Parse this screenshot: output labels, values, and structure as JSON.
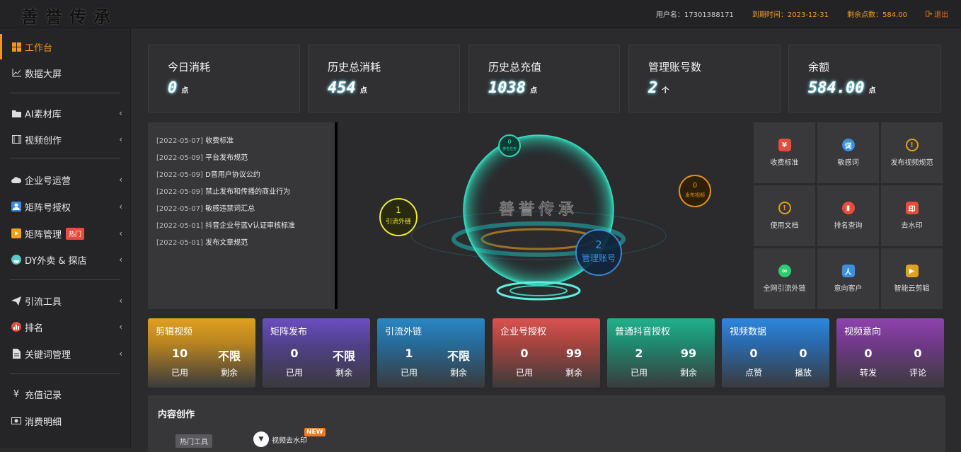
{
  "header": {
    "logo": "善誉传承",
    "user": "用户名：17301388171",
    "expire": "到期时间：2023-12-31",
    "points": "剩余点数：584.00",
    "logout": "退出"
  },
  "sidebar": {
    "items": [
      {
        "label": "工作台",
        "icon": "windows-icon"
      },
      {
        "label": "数据大屏",
        "icon": "chart-icon"
      },
      {
        "label": "AI素材库",
        "icon": "folder-icon"
      },
      {
        "label": "视频创作",
        "icon": "film-icon"
      },
      {
        "label": "企业号运营",
        "icon": "cloud-icon"
      },
      {
        "label": "矩阵号授权",
        "icon": "user-card-icon"
      },
      {
        "label": "矩阵管理",
        "icon": "play-icon",
        "badge": "热门"
      },
      {
        "label": "DY外卖 & 探店",
        "icon": "food-icon"
      },
      {
        "label": "引流工具",
        "icon": "send-icon"
      },
      {
        "label": "排名",
        "icon": "bar-icon"
      },
      {
        "label": "关键词管理",
        "icon": "doc-icon"
      },
      {
        "label": "充值记录",
        "icon": "yen-icon"
      },
      {
        "label": "消费明细",
        "icon": "money-icon"
      }
    ]
  },
  "cards": [
    {
      "label": "今日消耗",
      "value": "0",
      "unit": "点"
    },
    {
      "label": "历史总消耗",
      "value": "454",
      "unit": "点"
    },
    {
      "label": "历史总充值",
      "value": "1038",
      "unit": "点"
    },
    {
      "label": "管理账号数",
      "value": "2",
      "unit": "个"
    },
    {
      "label": "余额",
      "value": "584.00",
      "unit": "点"
    }
  ],
  "notices": [
    {
      "date": "[2022-05-07]",
      "title": "收费标准"
    },
    {
      "date": "[2022-05-09]",
      "title": "平台发布规范"
    },
    {
      "date": "[2022-05-09]",
      "title": "D音用户协议公约"
    },
    {
      "date": "[2022-05-09]",
      "title": "禁止发布和传播的商业行为"
    },
    {
      "date": "[2022-05-07]",
      "title": "敏感违禁词汇总"
    },
    {
      "date": "[2022-05-01]",
      "title": "抖音企业号蓝V认证审核标准"
    },
    {
      "date": "[2022-05-01]",
      "title": "发布文章规范"
    }
  ],
  "globe": {
    "center_text": "善誉传承",
    "bubbles": [
      {
        "num": "0",
        "label": "排名任务",
        "color": "#2ed8b0"
      },
      {
        "num": "1",
        "label": "引流外链",
        "color": "#e8e83a"
      },
      {
        "num": "0",
        "label": "发布视频",
        "color": "#e0901a"
      },
      {
        "num": "2",
        "label": "管理账号",
        "color": "#3a8fe0"
      }
    ]
  },
  "quick_links": [
    {
      "label": "收费标准",
      "icon": "tag-icon",
      "color": "#e74c3c",
      "glyph": "¥"
    },
    {
      "label": "敏感词",
      "icon": "shield-icon",
      "color": "#3a8fe0",
      "glyph": "词"
    },
    {
      "label": "发布视频规范",
      "icon": "alert-icon",
      "color": "#e0a020",
      "glyph": "!"
    },
    {
      "label": "使用文档",
      "icon": "alert-icon",
      "color": "#e0a020",
      "glyph": "!"
    },
    {
      "label": "排名查询",
      "icon": "bar-icon",
      "color": "#e74c3c",
      "glyph": "▮"
    },
    {
      "label": "去水印",
      "icon": "stamp-icon",
      "color": "#e74c3c",
      "glyph": "印"
    },
    {
      "label": "全网引流外链",
      "icon": "link-icon",
      "color": "#2ecc71",
      "glyph": "∞"
    },
    {
      "label": "意向客户",
      "icon": "user-icon",
      "color": "#3a8fe0",
      "glyph": "人"
    },
    {
      "label": "智能云剪辑",
      "icon": "video-icon",
      "color": "#e0a020",
      "glyph": "▶"
    }
  ],
  "stats": [
    {
      "title": "剪辑视频",
      "n1": "10",
      "l1": "已用",
      "n2": "不限",
      "l2": "剩余",
      "color": "#e0a020"
    },
    {
      "title": "矩阵发布",
      "n1": "0",
      "l1": "已用",
      "n2": "不限",
      "l2": "剩余",
      "color": "#6a4fc0"
    },
    {
      "title": "引流外链",
      "n1": "1",
      "l1": "已用",
      "n2": "不限",
      "l2": "剩余",
      "color": "#2a86c4"
    },
    {
      "title": "企业号授权",
      "n1": "0",
      "l1": "已用",
      "n2": "99",
      "l2": "剩余",
      "color": "#d9534f"
    },
    {
      "title": "普通抖音授权",
      "n1": "2",
      "l1": "已用",
      "n2": "99",
      "l2": "剩余",
      "color": "#22b08c"
    },
    {
      "title": "视频数据",
      "n1": "0",
      "l1": "点赞",
      "n2": "0",
      "l2": "播放",
      "color": "#2e86de"
    },
    {
      "title": "视频意向",
      "n1": "0",
      "l1": "转发",
      "n2": "0",
      "l2": "评论",
      "color": "#8e44ad"
    }
  ],
  "content": {
    "title": "内容创作",
    "tag": "热门工具",
    "tool": "视频去水印",
    "new_badge": "NEW"
  }
}
